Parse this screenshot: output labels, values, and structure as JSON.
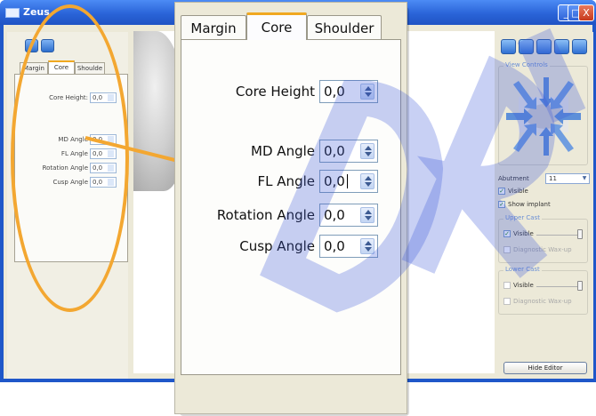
{
  "window": {
    "title": "Zeus",
    "buttons": {
      "minimize": "_",
      "maximize": "□",
      "close": "X"
    }
  },
  "tabs": [
    "Margin",
    "Core",
    "Shoulder"
  ],
  "small_tabs": [
    "Margin",
    "Core",
    "Shoulde"
  ],
  "fields": [
    {
      "label": "Core Height",
      "value": "0,0"
    },
    {
      "label": "MD Angle",
      "value": "0,0"
    },
    {
      "label": "FL Angle",
      "value": "0,0"
    },
    {
      "label": "Rotation Angle",
      "value": "0,0"
    },
    {
      "label": "Cusp Angle",
      "value": "0,0"
    }
  ],
  "small_fields": [
    {
      "label": "Core Height:",
      "value": "0,0"
    },
    {
      "label": "MD Angle",
      "value": "0,0"
    },
    {
      "label": "FL Angle",
      "value": "0,0"
    },
    {
      "label": "Rotation Angle",
      "value": "0,0"
    },
    {
      "label": "Cusp Angle",
      "value": "0,0"
    }
  ],
  "right_panel": {
    "view_controls_label": "View Controls",
    "abutment_label": "Abutment",
    "abutment_value": "11",
    "visible_label": "Visible",
    "show_implant_label": "Show implant",
    "upper_cast_label": "Upper Cast",
    "upper_visible_label": "Visible",
    "upper_wax_label": "Diagnostic Wax-up",
    "lower_cast_label": "Lower Cast",
    "lower_visible_label": "Visible",
    "lower_wax_label": "Diagnostic Wax-up",
    "hide_editor_label": "Hide Editor"
  },
  "colors": {
    "annotation": "#f3a731",
    "watermark": "#3b55d8",
    "active_tab_accent": "#f0a820"
  }
}
